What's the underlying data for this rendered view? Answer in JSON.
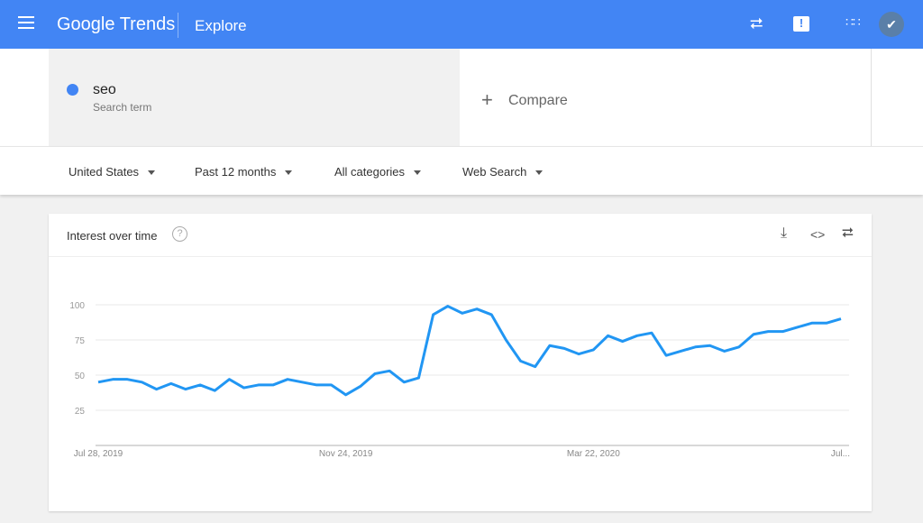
{
  "header": {
    "app_title": "Google Trends",
    "section": "Explore",
    "icons": [
      "menu-icon",
      "share-icon",
      "feedback-icon",
      "apps-icon",
      "account-avatar"
    ]
  },
  "search": {
    "term": "seo",
    "term_type": "Search term",
    "term_color": "#4285f4",
    "compare_label": "Compare"
  },
  "filters": {
    "region": "United States",
    "time": "Past 12 months",
    "category": "All categories",
    "search_type": "Web Search"
  },
  "card": {
    "title": "Interest over time",
    "icons": [
      "help-icon",
      "download-icon",
      "embed-icon",
      "share-icon"
    ]
  },
  "chart_data": {
    "type": "line",
    "title": "Interest over time",
    "y_ticks": [
      "25",
      "50",
      "75",
      "100"
    ],
    "x_ticks": [
      "Jul 28, 2019",
      "Nov 24, 2019",
      "Mar 22, 2020",
      "Jul..."
    ],
    "x_tick_index": [
      0,
      17,
      34,
      51
    ],
    "ylim": [
      0,
      100
    ],
    "grid": true,
    "line_color": "#2196f3",
    "series": [
      {
        "name": "seo",
        "values": [
          45,
          47,
          47,
          45,
          40,
          44,
          40,
          43,
          39,
          47,
          41,
          43,
          43,
          47,
          45,
          43,
          43,
          36,
          42,
          51,
          53,
          45,
          48,
          93,
          99,
          94,
          97,
          93,
          75,
          60,
          56,
          71,
          69,
          65,
          68,
          78,
          74,
          78,
          80,
          64,
          67,
          70,
          71,
          67,
          70,
          79,
          81,
          81,
          84,
          87,
          87,
          90
        ]
      }
    ]
  }
}
